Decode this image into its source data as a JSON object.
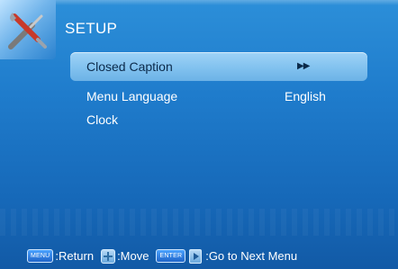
{
  "header": {
    "title": "SETUP",
    "icon": "tools-icon"
  },
  "menu": {
    "items": [
      {
        "label": "Closed Caption",
        "value": "",
        "has_submenu": true,
        "selected": true
      },
      {
        "label": "Menu Language",
        "value": "English",
        "has_submenu": false,
        "selected": false
      },
      {
        "label": "Clock",
        "value": "",
        "has_submenu": false,
        "selected": false
      }
    ],
    "submenu_arrows": "▶▶"
  },
  "footer": {
    "menu_key": "MENU",
    "return_label": ":Return",
    "move_label": ":Move",
    "enter_key": "ENTER",
    "next_label": ":Go to Next Menu"
  },
  "colors": {
    "background": "#1f7ccc",
    "highlight": "#7fc0ee",
    "text": "#ffffff"
  }
}
